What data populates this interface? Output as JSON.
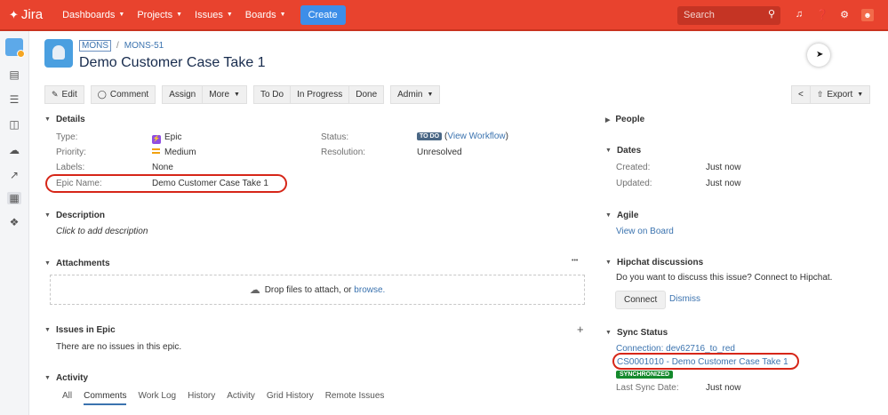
{
  "topbar": {
    "logo": "Jira",
    "nav": [
      {
        "label": "Dashboards"
      },
      {
        "label": "Projects"
      },
      {
        "label": "Issues"
      },
      {
        "label": "Boards"
      }
    ],
    "create_label": "Create",
    "search_placeholder": "Search",
    "icons": [
      "notification-icon",
      "help-icon",
      "settings-icon",
      "user-avatar"
    ],
    "colors": {
      "bar": "#e8432e",
      "create": "#3d8ee8"
    }
  },
  "sidebar": {
    "icons": [
      "project-avatar",
      "backlog-icon",
      "board-icon",
      "releases-icon",
      "components-icon",
      "reports-icon",
      "issues-icon",
      "add-ons-icon"
    ]
  },
  "header": {
    "breadcrumb_project": "MONS",
    "breadcrumb_separator": "/",
    "breadcrumb_issue": "MONS-51",
    "title": "Demo Customer Case Take 1"
  },
  "toolbar": {
    "edit": "Edit",
    "comment": "Comment",
    "assign": "Assign",
    "more": "More",
    "todo": "To Do",
    "in_progress": "In Progress",
    "done": "Done",
    "admin": "Admin",
    "export": "Export"
  },
  "details": {
    "heading": "Details",
    "type_label": "Type:",
    "type_value": "Epic",
    "priority_label": "Priority:",
    "priority_value": "Medium",
    "labels_label": "Labels:",
    "labels_value": "None",
    "epic_name_label": "Epic Name:",
    "epic_name_value": "Demo Customer Case Take 1",
    "status_label": "Status:",
    "status_value": "TO DO",
    "status_link_open": "(",
    "status_link": "View Workflow",
    "status_link_close": ")",
    "resolution_label": "Resolution:",
    "resolution_value": "Unresolved"
  },
  "description": {
    "heading": "Description",
    "placeholder": "Click to add description"
  },
  "attachments": {
    "heading": "Attachments",
    "more": "•••",
    "drop_text": "Drop files to attach, or ",
    "browse": "browse."
  },
  "issues_in_epic": {
    "heading": "Issues in Epic",
    "empty": "There are no issues in this epic.",
    "add": "+"
  },
  "activity": {
    "heading": "Activity",
    "tabs": [
      {
        "label": "All"
      },
      {
        "label": "Comments"
      },
      {
        "label": "Work Log"
      },
      {
        "label": "History"
      },
      {
        "label": "Activity"
      },
      {
        "label": "Grid History"
      },
      {
        "label": "Remote Issues"
      }
    ],
    "active_tab": "Comments"
  },
  "people": {
    "heading": "People"
  },
  "dates": {
    "heading": "Dates",
    "created_label": "Created:",
    "created_value": "Just now",
    "updated_label": "Updated:",
    "updated_value": "Just now"
  },
  "agile": {
    "heading": "Agile",
    "link": "View on Board"
  },
  "hipchat": {
    "heading": "Hipchat discussions",
    "prompt": "Do you want to discuss this issue? Connect to Hipchat.",
    "connect": "Connect",
    "dismiss": "Dismiss"
  },
  "sync": {
    "heading": "Sync Status",
    "connection": "Connection: dev62716_to_red",
    "case_link": "CS0001010 - Demo Customer Case Take 1",
    "status": "SYNCHRONIZED",
    "last_sync_label": "Last Sync Date:",
    "last_sync_value": "Just now"
  }
}
